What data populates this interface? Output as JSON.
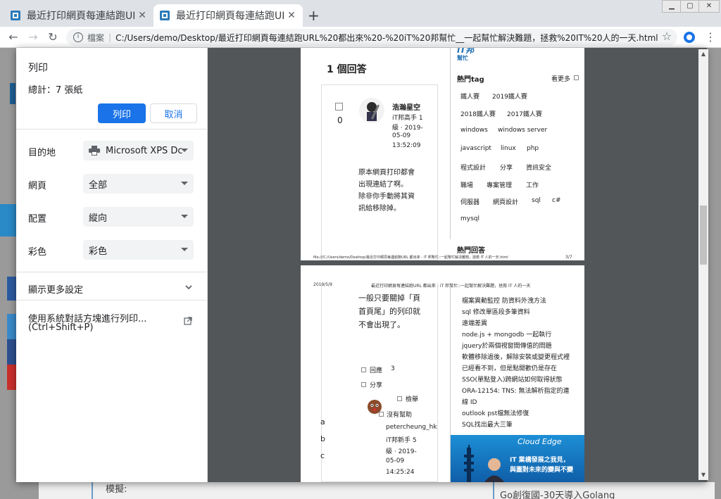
{
  "tabs": [
    {
      "title": "最近打印網頁每連結跑UI"
    },
    {
      "title": "最近打印網頁每連結跑UI"
    }
  ],
  "toolbar": {
    "omnibox_label": "檔案",
    "url": "C:/Users/demo/Desktop/最近打印網頁每連結跑URL%20都出來%20-%20iT%20邦幫忙__一起幫忙解決難題，拯救%20IT%20人的一天.html"
  },
  "print": {
    "title": "列印",
    "total": "總計：7 張紙",
    "print_button": "列印",
    "cancel_button": "取消",
    "destination_label": "目的地",
    "destination_value": "Microsoft XPS Dc",
    "pages_label": "網頁",
    "pages_value": "全部",
    "layout_label": "配置",
    "layout_value": "縱向",
    "color_label": "彩色",
    "color_value": "彩色",
    "more_settings": "顯示更多設定",
    "system_dialog": "使用系統對話方塊進行列印...",
    "system_dialog_shortcut": "(Ctrl+Shift+P)"
  },
  "preview": {
    "page3": {
      "answer_count_title": "1 個回答",
      "vote_count": "0",
      "user_name": "浩瀚星空",
      "user_meta": [
        "iT邦高手 1",
        "級 · 2019-",
        "05-09",
        "13:52:09"
      ],
      "answer_text": [
        "原本網頁打印都會",
        "出現連結了啊。",
        "除非你手動將其資",
        "訊給移除掉。"
      ],
      "logo_text": "iT邦",
      "logo_sub": "幫忙",
      "hot_tags_title": "熱門tag",
      "see_more": "看更多",
      "tags": [
        [
          "鐵人賽",
          "2019鐵人賽"
        ],
        [
          "2018鐵人賽",
          "2017鐵人賽"
        ],
        [
          "windows",
          "windows server"
        ],
        [
          "javascript",
          "linux",
          "php"
        ],
        [
          "程式設計",
          "分享",
          "資訊安全"
        ],
        [
          "職場",
          "專案管理",
          "工作"
        ],
        [
          "伺服器",
          "網頁設計",
          "sql",
          "c#"
        ],
        [
          "mysql"
        ]
      ],
      "hot_answers_title": "熱門回答",
      "footer_left": "file:///C:/Users/demo/Desktop/最近打印網頁每連結跑URL 都出來 - iT 邦幫忙::一起幫忙解決難題，拯救 IT 人的一天.html",
      "footer_right": "3/7"
    },
    "page4": {
      "header_left": "2019/5/9",
      "header_center": "最近打印網頁每連結跑URL 都出來 - iT 邦幫忙::一起幫忙解決難題，拯救 IT 人的一天",
      "body_text": [
        "一般只要關掉「頁",
        "首頁尾」的列印就",
        "不會出現了。"
      ],
      "reply_label": "回應",
      "reply_count": "3",
      "share_label": "分享",
      "report_label": "檢舉",
      "not_helpful": "沒有幫助",
      "commenter": "petercheung_hk",
      "commenter_meta": [
        "iT邦新手 5",
        "級 · 2019-",
        "05-09",
        "14:25:24"
      ],
      "side_letters": [
        "a",
        "b",
        "c"
      ],
      "hot_answers": [
        "檔案異動監控 防資料外洩方法",
        "sql 修改單區段多筆資料",
        "遠端差異",
        "node.js + mongodb 一起執行",
        "jquery於兩個視窗間傳值的問題",
        "軟體移除過後，解除安裝或變更程式裡",
        "已經看不到，但是點開歡仍是存在",
        "SSO(單點登入)跨網站如何取得狀態",
        "ORA-12154: TNS: 無法解析指定的連",
        "線 ID",
        "outlook pst檔無法修復",
        "SQL找出最大三筆"
      ],
      "ad_brand": "Cloud Edge",
      "ad_line1": "IT 業構發展之我見，",
      "ad_line2": "與圖對未來的變與不變"
    }
  },
  "background": {
    "left_label": "模擬:",
    "right_label": "Go創復國-30天導入Golang"
  }
}
